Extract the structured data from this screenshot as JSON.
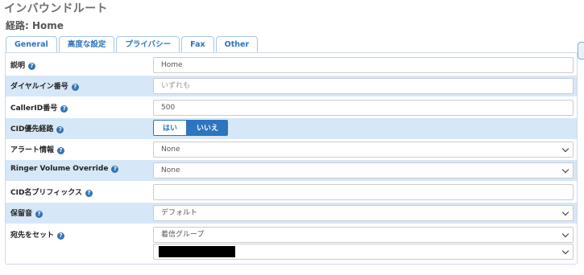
{
  "header": {
    "title": "インバウンドルート",
    "route": "経路: Home"
  },
  "tabs": [
    {
      "label": "General",
      "active": true
    },
    {
      "label": "高度な設定",
      "active": false
    },
    {
      "label": "プライバシー",
      "active": false
    },
    {
      "label": "Fax",
      "active": false
    },
    {
      "label": "Other",
      "active": false
    }
  ],
  "form": {
    "description": {
      "label": "説明",
      "value": "Home"
    },
    "did_number": {
      "label": "ダイヤルイン番号",
      "placeholder": "いずれも"
    },
    "caller_id": {
      "label": "CallerID番号",
      "value": "500"
    },
    "cid_priority": {
      "label": "CID優先経路",
      "options": [
        "はい",
        "いいえ"
      ],
      "selected": "いいえ"
    },
    "alert_info": {
      "label": "アラート情報",
      "value": "None"
    },
    "ringer_volume": {
      "label": "Ringer Volume Override",
      "value": "None"
    },
    "cid_prefix": {
      "label": "CID名プリフィックス",
      "value": ""
    },
    "music_on_hold": {
      "label": "保留音",
      "value": "デフォルト"
    },
    "destination": {
      "label": "宛先をセット",
      "value": "着信グループ",
      "target_value": ""
    }
  },
  "help_icon_glyph": "?"
}
